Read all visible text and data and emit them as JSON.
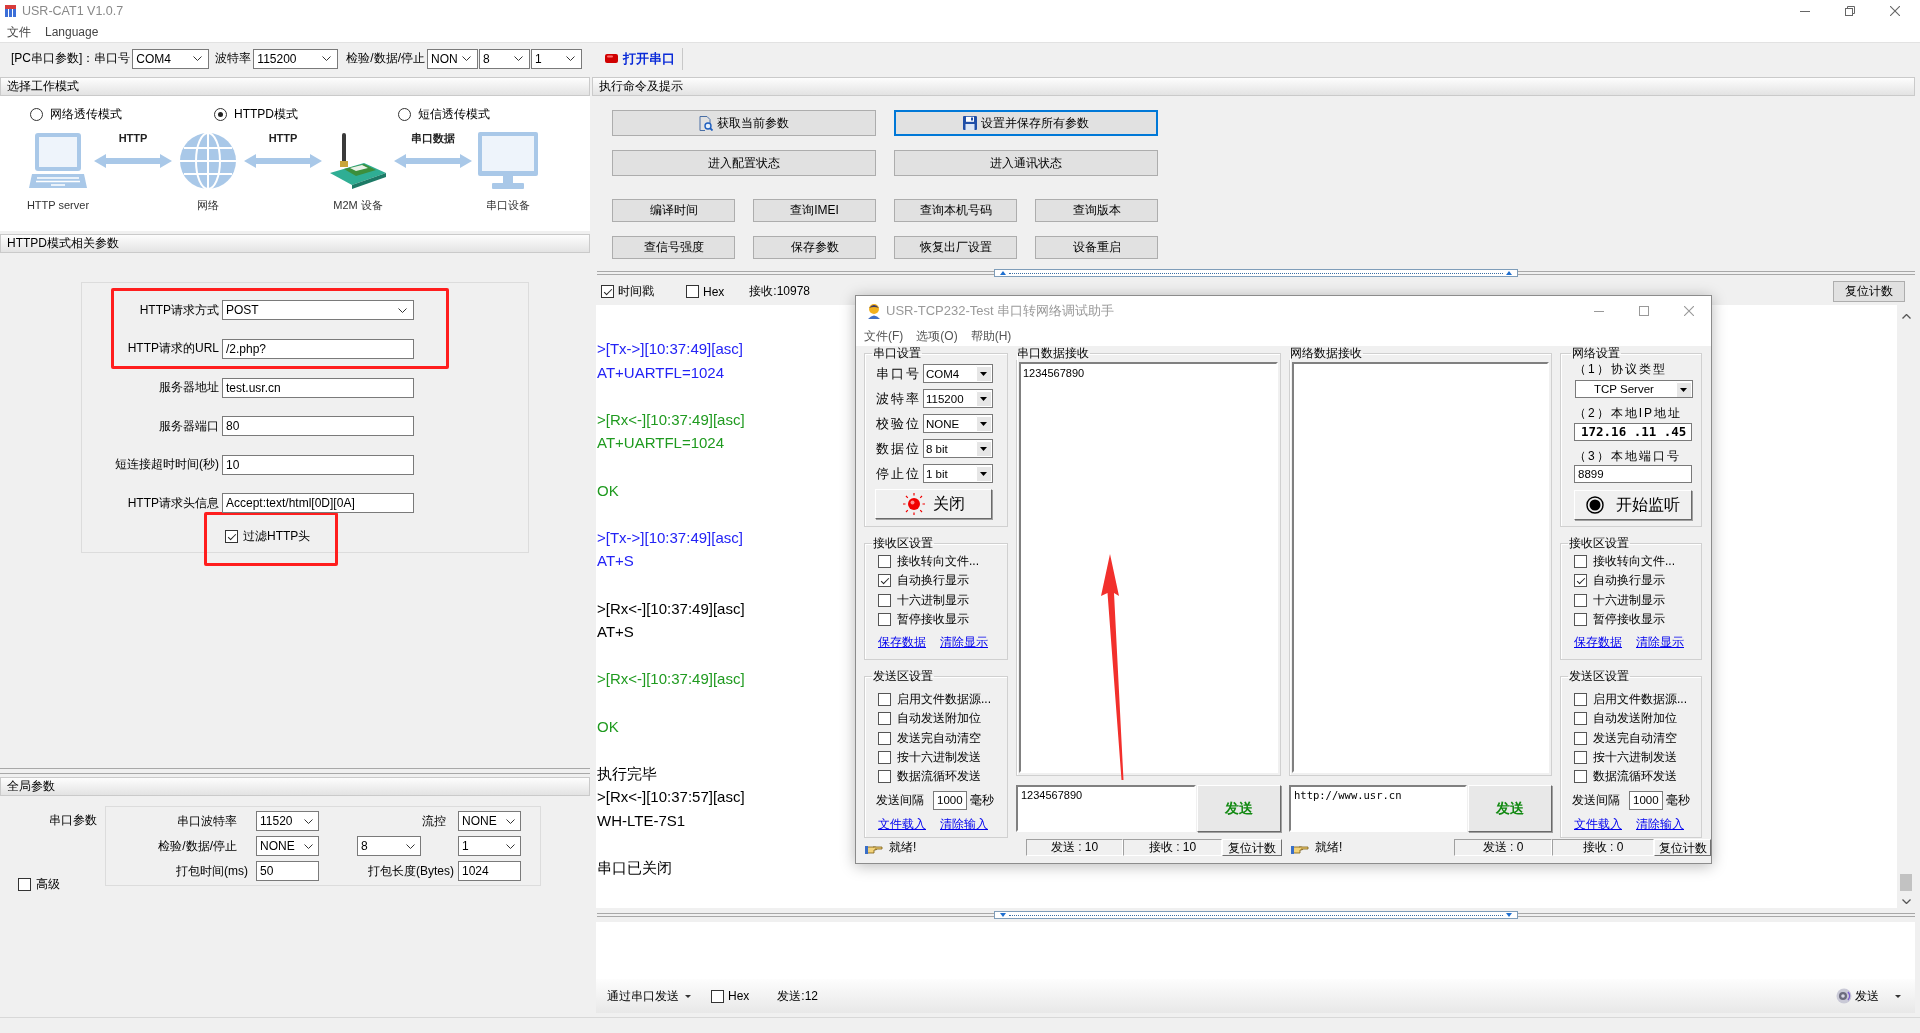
{
  "window": {
    "title": "USR-CAT1 V1.0.7"
  },
  "menu": [
    "文件",
    "Language"
  ],
  "toolbar": {
    "port_label": "[PC串口参数]：串口号",
    "port": "COM4",
    "baud_label": "波特率",
    "baud": "115200",
    "frame_label": "检验/数据/停止",
    "parity": "NON",
    "data_bits": "8",
    "stop_bits": "1",
    "open_button": "打开串口"
  },
  "mode_panel": {
    "title": "选择工作模式",
    "modes": [
      {
        "label": "网络透传模式",
        "selected": false
      },
      {
        "label": "HTTPD模式",
        "selected": true
      },
      {
        "label": "短信透传模式",
        "selected": false
      }
    ],
    "diagram": {
      "nodes": [
        {
          "kind": "laptop",
          "label": "HTTP server"
        },
        {
          "kind": "globe",
          "label": "网络"
        },
        {
          "kind": "module",
          "label": "M2M 设备"
        },
        {
          "kind": "monitor",
          "label": "串口设备"
        }
      ],
      "links": [
        "HTTP",
        "HTTP",
        "串口数据"
      ]
    }
  },
  "httpd_panel": {
    "title": "HTTPD模式相关参数",
    "fields": [
      {
        "kind": "select",
        "label": "HTTP请求方式",
        "value": "POST",
        "highlighted": true
      },
      {
        "kind": "text",
        "label": "HTTP请求的URL",
        "value": "/2.php?",
        "highlighted": true
      },
      {
        "kind": "text",
        "label": "服务器地址",
        "value": "test.usr.cn",
        "highlighted": false
      },
      {
        "kind": "text",
        "label": "服务器端口",
        "value": "80",
        "highlighted": false
      },
      {
        "kind": "text",
        "label": "短连接超时时间(秒)",
        "value": "10",
        "highlighted": false
      },
      {
        "kind": "text",
        "label": "HTTP请求头信息",
        "value": "Accept:text/html[0D][0A]",
        "highlighted": false
      }
    ],
    "filter_header": {
      "label": "过滤HTTP头",
      "checked": true,
      "highlighted": true
    }
  },
  "global_panel": {
    "title": "全局参数",
    "group_label": "串口参数",
    "baud_label": "串口波特率",
    "baud": "11520",
    "flow_label": "流控",
    "flow": "NONE",
    "frame_label": "检验/数据/停止",
    "parity": "NONE",
    "data_bits": "8",
    "stop_bits": "1",
    "pack_time_label": "打包时间(ms)",
    "pack_time": "50",
    "pack_length_label": "打包长度(Bytes)",
    "pack_length": "1024",
    "advanced": {
      "label": "高级",
      "checked": false
    }
  },
  "command_panel": {
    "title": "执行命令及提示",
    "main_buttons": [
      {
        "kind": "fetch",
        "label": "获取当前参数",
        "focused": false
      },
      {
        "kind": "save",
        "label": "设置并保存所有参数",
        "focused": true
      },
      {
        "kind": "plain",
        "label": "进入配置状态",
        "focused": false
      },
      {
        "kind": "plain",
        "label": "进入通讯状态",
        "focused": false
      }
    ],
    "query_buttons": [
      "编译时间",
      "查询IMEI",
      "查询本机号码",
      "查询版本",
      "查信号强度",
      "保存参数",
      "恢复出厂设置",
      "设备重启"
    ]
  },
  "log": {
    "timestamp": {
      "label": "时间戳",
      "checked": true
    },
    "hex": {
      "label": "Hex",
      "checked": false
    },
    "rx_count": "接收:10978",
    "reset_button": "复位计数",
    "entries": [
      {
        "color": "#2323f5",
        "lines": [
          ">[Tx->][10:37:49][asc]",
          "AT+UARTFL=1024"
        ]
      },
      {
        "color": "#1f9a1f",
        "lines": [
          ">[Rx<-][10:37:49][asc]",
          "AT+UARTFL=1024"
        ]
      },
      {
        "color": "#1f9a1f",
        "lines": [
          "OK"
        ]
      },
      {
        "color": "#2323f5",
        "lines": [
          ">[Tx->][10:37:49][asc]",
          "AT+S"
        ]
      },
      {
        "color": "#000000",
        "lines": [
          ">[Rx<-][10:37:49][asc]",
          "AT+S"
        ]
      },
      {
        "color": "#1f9a1f",
        "lines": [
          ">[Rx<-][10:37:49][asc]"
        ]
      },
      {
        "color": "#1f9a1f",
        "lines": [
          "OK"
        ]
      },
      {
        "color": "#000000",
        "lines": [
          "执行完毕",
          ">[Rx<-][10:37:57][asc]",
          "WH-LTE-7S1"
        ]
      },
      {
        "color": "#000000",
        "lines": [
          "串口已关闭"
        ]
      }
    ]
  },
  "send_bar": {
    "mode": "通过串口发送",
    "hex": {
      "label": "Hex",
      "checked": false
    },
    "tx_count": "发送:12",
    "send_button": "发送"
  },
  "assistant": {
    "title": "USR-TCP232-Test 串口转网络调试助手",
    "menu": [
      "文件(F)",
      "选项(O)",
      "帮助(H)"
    ],
    "serial_settings": {
      "title": "串口设置",
      "fields": [
        {
          "label": "串口号",
          "value": "COM4"
        },
        {
          "label": "波特率",
          "value": "115200"
        },
        {
          "label": "校验位",
          "value": "NONE"
        },
        {
          "label": "数据位",
          "value": "8 bit"
        },
        {
          "label": "停止位",
          "value": "1 bit"
        }
      ],
      "close_button": "关闭"
    },
    "serial_receive_settings": {
      "title": "接收区设置",
      "options": [
        {
          "label": "接收转向文件...",
          "checked": false
        },
        {
          "label": "自动换行显示",
          "checked": true
        },
        {
          "label": "十六进制显示",
          "checked": false
        },
        {
          "label": "暂停接收显示",
          "checked": false
        }
      ],
      "links": [
        "保存数据",
        "清除显示"
      ]
    },
    "serial_send_settings": {
      "title": "发送区设置",
      "options": [
        {
          "label": "启用文件数据源...",
          "checked": false
        },
        {
          "label": "自动发送附加位",
          "checked": false
        },
        {
          "label": "发送完自动清空",
          "checked": false
        },
        {
          "label": "按十六进制发送",
          "checked": false
        },
        {
          "label": "数据流循环发送",
          "checked": false
        }
      ],
      "interval_label": "发送间隔",
      "interval": "1000",
      "interval_unit": "毫秒",
      "links": [
        "文件载入",
        "清除输入"
      ]
    },
    "serial_receive": {
      "title": "串口数据接收",
      "text": "1234567890"
    },
    "serial_send": {
      "text": "1234567890",
      "button": "发送"
    },
    "network_receive": {
      "title": "网络数据接收"
    },
    "network_send": {
      "text": "http://www.usr.cn",
      "button": "发送"
    },
    "network_settings": {
      "title": "网络设置",
      "protocol_label": "（1）协议类型",
      "protocol": "TCP Server",
      "ip_label": "（2）本地IP地址",
      "ip": "172.16 .11 .45",
      "port_label": "（3）本地端口号",
      "port": "8899",
      "listen_button": "开始监听"
    },
    "network_receive_settings": {
      "title": "接收区设置",
      "options": [
        {
          "label": "接收转向文件...",
          "checked": false
        },
        {
          "label": "自动换行显示",
          "checked": true
        },
        {
          "label": "十六进制显示",
          "checked": false
        },
        {
          "label": "暂停接收显示",
          "checked": false
        }
      ],
      "links": [
        "保存数据",
        "清除显示"
      ]
    },
    "network_send_settings": {
      "title": "发送区设置",
      "options": [
        {
          "label": "启用文件数据源...",
          "checked": false
        },
        {
          "label": "自动发送附加位",
          "checked": false
        },
        {
          "label": "发送完自动清空",
          "checked": false
        },
        {
          "label": "按十六进制发送",
          "checked": false
        },
        {
          "label": "数据流循环发送",
          "checked": false
        }
      ],
      "interval_label": "发送间隔",
      "interval": "1000",
      "interval_unit": "毫秒",
      "links": [
        "文件载入",
        "清除输入"
      ]
    },
    "serial_status": {
      "text": "就绪!",
      "tx": "发送 : 10",
      "rx": "接收 : 10",
      "reset": "复位计数"
    },
    "network_status": {
      "text": "就绪!",
      "tx": "发送 : 0",
      "rx": "接收 : 0",
      "reset": "复位计数"
    }
  }
}
